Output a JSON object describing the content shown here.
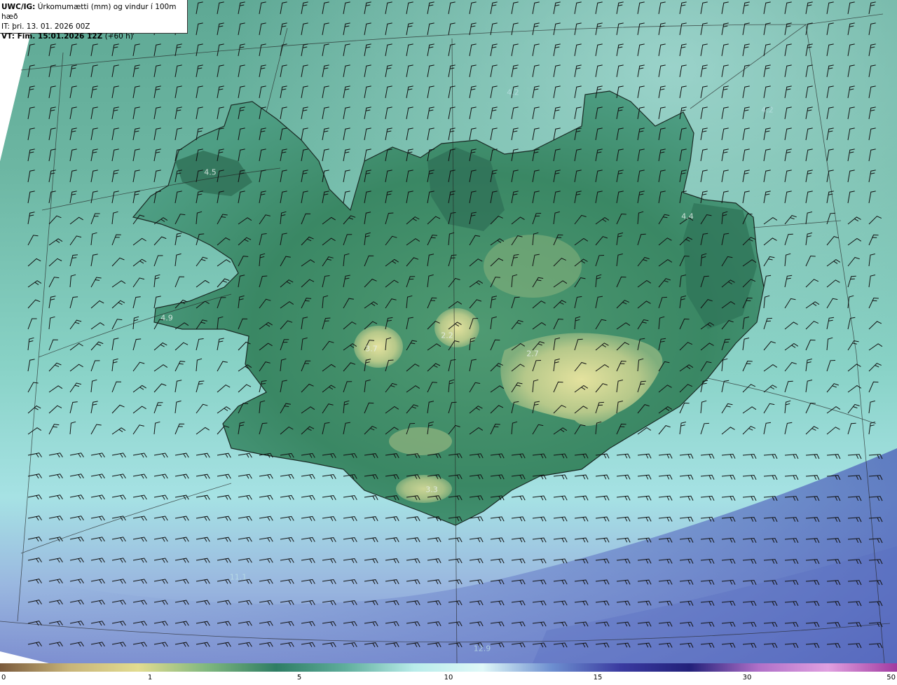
{
  "header": {
    "product": "UWC/IG:",
    "product_desc": "Úrkomumætti (mm) og vindur í 100m hæð",
    "issue_time": "IT: þri. 13. 01. 2026 00Z",
    "valid_label": "VT: Fim. 15.01.2026 12Z",
    "valid_offset": "(+60 h)"
  },
  "map_labels": [
    {
      "id": "westfjords",
      "text": "4.5"
    },
    {
      "id": "snaefellsnes",
      "text": "4.9"
    },
    {
      "id": "langjokull",
      "text": "3.7"
    },
    {
      "id": "hofsjokull",
      "text": "2.2"
    },
    {
      "id": "vatnajokull",
      "text": "2.7"
    },
    {
      "id": "east",
      "text": "4.4"
    },
    {
      "id": "south",
      "text": "3.3"
    },
    {
      "id": "north-sea",
      "text": "4.2"
    },
    {
      "id": "ne-sea",
      "text": "4.2"
    },
    {
      "id": "sw-sea",
      "text": "11.1"
    },
    {
      "id": "south-sea",
      "text": "12.9"
    }
  ],
  "colorbar": {
    "ticks": [
      "0",
      "1",
      "5",
      "10",
      "15",
      "30",
      "50"
    ],
    "colors": [
      "#7a5a3c",
      "#c8b478",
      "#e2dc90",
      "#7fb77e",
      "#2e7d64",
      "#5fae9c",
      "#b9ecea",
      "#dff8f8",
      "#6d8fd0",
      "#3a3aa0",
      "#22207a",
      "#b070c8",
      "#e0a0e0",
      "#a03aa0"
    ]
  },
  "legend_colors": {
    "land_low": "#2f7d5c",
    "land_high": "#d8d68e",
    "sea_near": "#7cc8b8",
    "sea_far": "#a8dcea",
    "heavy": "#6d84c8"
  }
}
